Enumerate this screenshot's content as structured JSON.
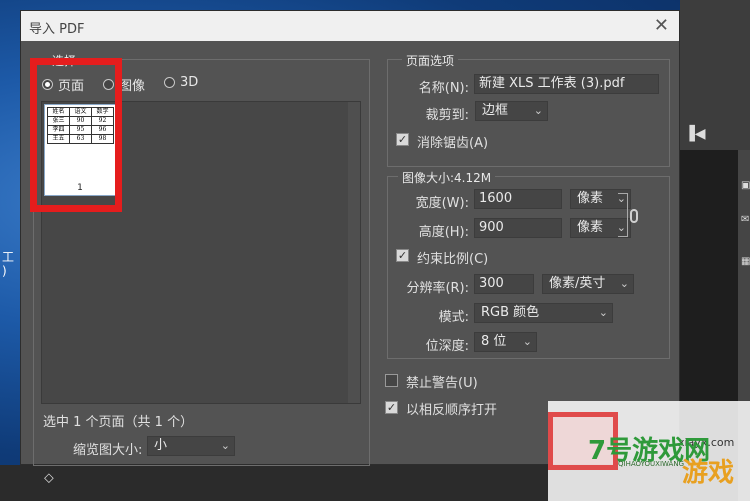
{
  "desktop": {
    "side_char_1": "工",
    "side_char_2": ")"
  },
  "dialog": {
    "title": "导入 PDF",
    "close_symbol": "✕",
    "select_group": {
      "legend": "选择:",
      "options": [
        {
          "label": "页面",
          "checked": true
        },
        {
          "label": "图像",
          "checked": false
        },
        {
          "label": "3D",
          "checked": false
        }
      ],
      "thumbnail": {
        "table": [
          [
            "姓名",
            "语文",
            "数学"
          ],
          [
            "张三",
            "90",
            "92"
          ],
          [
            "李四",
            "95",
            "96"
          ],
          [
            "王五",
            "63",
            "98"
          ]
        ],
        "page_number": "1"
      },
      "status": "选中 1 个页面（共 1 个）",
      "thumb_size_label": "缩览图大小:",
      "thumb_size_value": "小"
    },
    "page_options": {
      "legend": "页面选项",
      "name_label": "名称(N):",
      "name_value": "新建 XLS 工作表 (3).pdf",
      "crop_label": "裁剪到:",
      "crop_value": "边框",
      "antialias_label": "消除锯齿(A)",
      "antialias_checked": true
    },
    "image_size": {
      "legend": "图像大小:4.12M",
      "width_label": "宽度(W):",
      "width_value": "1600",
      "width_unit": "像素",
      "height_label": "高度(H):",
      "height_value": "900",
      "height_unit": "像素",
      "constrain_label": "约束比例(C)",
      "constrain_checked": true,
      "resolution_label": "分辨率(R):",
      "resolution_value": "300",
      "resolution_unit": "像素/英寸",
      "mode_label": "模式:",
      "mode_value": "RGB 颜色",
      "depth_label": "位深度:",
      "depth_value": "8 位"
    },
    "suppress_warnings_label": "禁止警告(U)",
    "suppress_warnings_checked": false,
    "reverse_order_label": "以相反顺序打开",
    "reverse_order_checked": true
  },
  "watermark": {
    "site": "xiayx.com",
    "big_text": "7号游戏网",
    "sub_text": "QIHAOYOUXIWANG",
    "game_text": "游戏"
  },
  "colors": {
    "highlight_red": "#e51d1d",
    "dialog_bg": "#535353"
  }
}
